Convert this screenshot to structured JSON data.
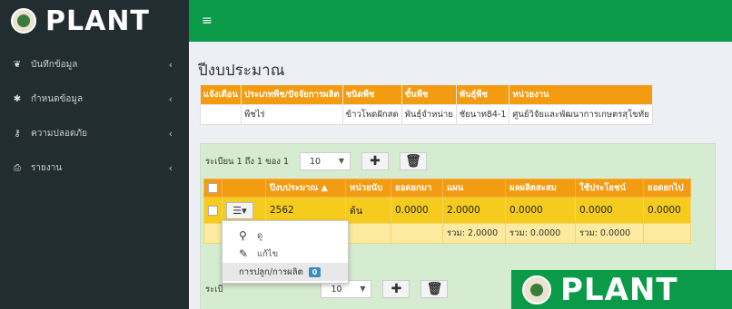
{
  "brand": {
    "name": "PLANT"
  },
  "topbar": {
    "menu_icon": "≡"
  },
  "sidebar": {
    "items": [
      {
        "label": "บันทึกข้อมูล",
        "icon": "seedling-icon",
        "glyph": "❦"
      },
      {
        "label": "กำหนดข้อมูล",
        "icon": "gear-icon",
        "glyph": "✱"
      },
      {
        "label": "ความปลอดภัย",
        "icon": "key-icon",
        "glyph": "⚷"
      },
      {
        "label": "รายงาน",
        "icon": "print-icon",
        "glyph": "⎙"
      }
    ]
  },
  "page": {
    "title": "ปีงบประมาณ"
  },
  "info_table": {
    "headers": [
      "แจ้งเตือน",
      "ประเภทพืช/ปัจจัยการผลิต",
      "ชนิดพืช",
      "ขั้นพืช",
      "พันธุ์พืช",
      "หน่วยงาน"
    ],
    "row": [
      "",
      "พืชไร่",
      "ข้าวโพดฝักสด",
      "พันธุ์จำหน่าย",
      "ชัยนาท84-1",
      "ศูนย์วิจัยและพัฒนาการเกษตรสุโขทัย"
    ]
  },
  "pager": {
    "text": "ระเบียน 1 ถึง 1 ของ 1",
    "page_size": "10",
    "bottom_text": "ระเบี"
  },
  "grid": {
    "headers": [
      "",
      "",
      "ปีงบประมาณ ▲",
      "หน่วยนับ",
      "ยอดยกมา",
      "แผน",
      "ผลผลิตสะสม",
      "ใช้ประโยชน์",
      "ยอดยกไป"
    ],
    "row": [
      "2562",
      "ต้น",
      "0.0000",
      "2.0000",
      "0.0000",
      "0.0000",
      "0.0000"
    ],
    "sums": [
      "รวม: 2.0000",
      "รวม: 0.0000",
      "รวม: 0.0000"
    ]
  },
  "dropdown": {
    "items": [
      {
        "label": "ดู",
        "icon": "search-icon",
        "glyph": "⚲"
      },
      {
        "label": "แก้ไข",
        "icon": "pencil-icon",
        "glyph": "✎"
      },
      {
        "label": "การปลูก/การผลิต",
        "badge": "0"
      }
    ]
  },
  "colors": {
    "sidebar": "#222d32",
    "header_green": "#0a9a48",
    "orange": "#f39c12",
    "yellow_row": "#f5cc1e",
    "box_green": "#d6ecd0"
  }
}
